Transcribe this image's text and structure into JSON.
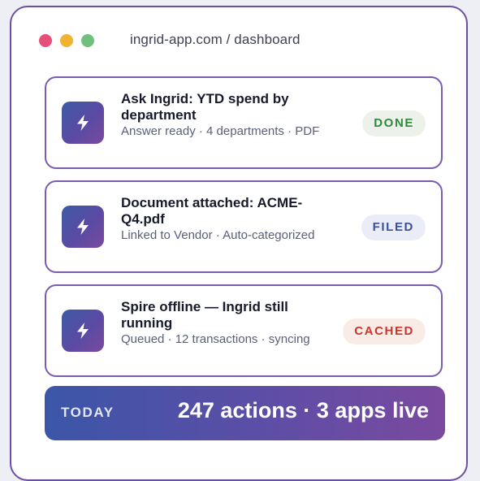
{
  "window": {
    "url": "ingrid-app.com / dashboard",
    "traffic_lights": {
      "close_color": "#e5507a",
      "minimize_color": "#f2b233",
      "maximize_color": "#6fbf7d"
    }
  },
  "cards": [
    {
      "title": "Ask Ingrid: YTD spend by department",
      "subtitle": "Answer ready · 4 departments · PDF",
      "icon": "bolt-icon",
      "status": "DONE",
      "status_color": "#2e8a3c"
    },
    {
      "title": "Document attached: ACME-Q4.pdf",
      "subtitle": "Linked to Vendor · Auto-categorized",
      "icon": "bolt-icon",
      "status": "FILED",
      "status_color": "#3b4f9c"
    },
    {
      "title": "Spire offline — Ingrid still running",
      "subtitle": "Queued · 12 transactions · syncing",
      "icon": "bolt-icon",
      "status": "CACHED",
      "status_color": "#c8372d"
    }
  ],
  "footer": {
    "label": "TODAY",
    "stats": "247 actions · 3 apps live"
  }
}
